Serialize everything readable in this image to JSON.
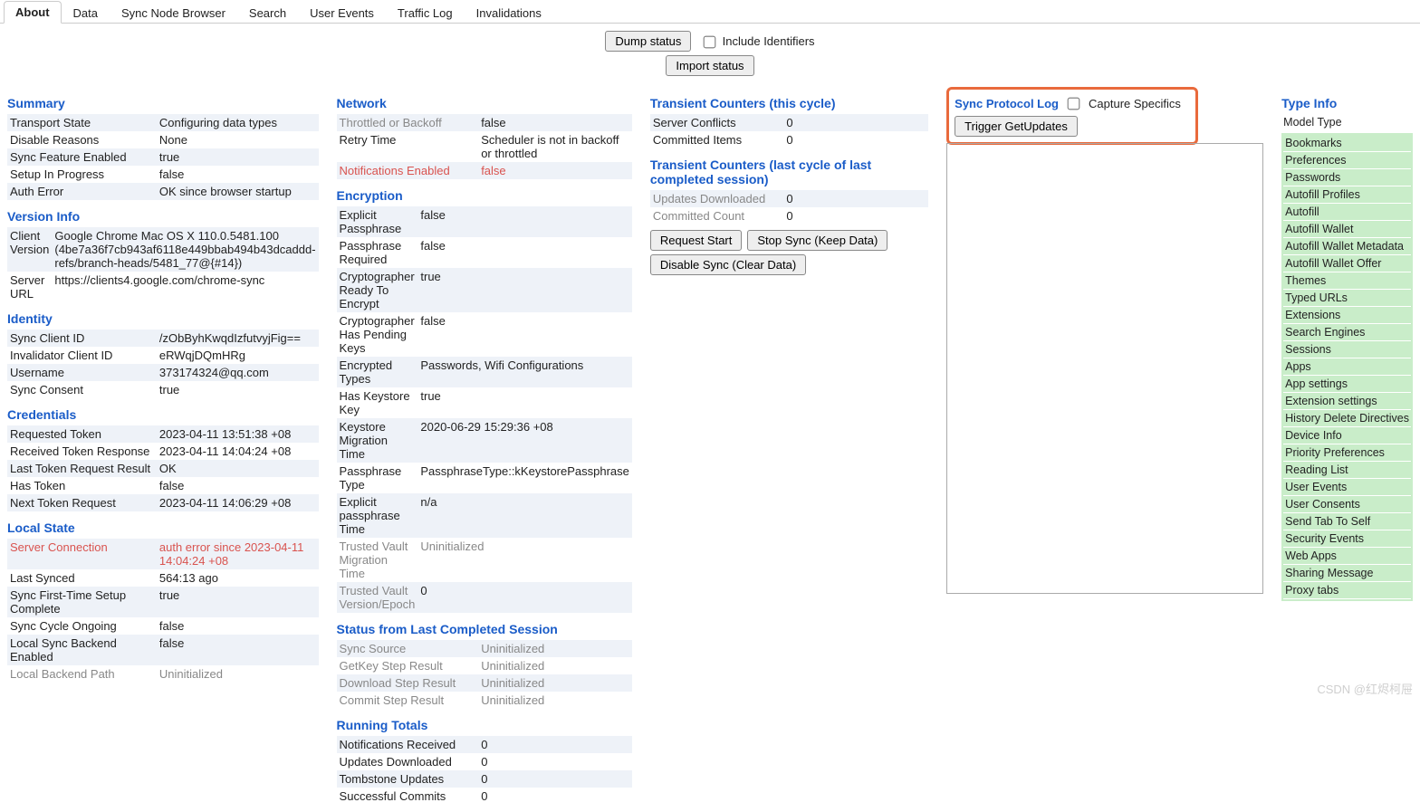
{
  "tabs": [
    "About",
    "Data",
    "Sync Node Browser",
    "Search",
    "User Events",
    "Traffic Log",
    "Invalidations"
  ],
  "activeTab": "About",
  "toolbar": {
    "dump": "Dump status",
    "include": "Include Identifiers",
    "import": "Import status"
  },
  "summary": {
    "title": "Summary",
    "rows": [
      [
        "Transport State",
        "Configuring data types"
      ],
      [
        "Disable Reasons",
        "None"
      ],
      [
        "Sync Feature Enabled",
        "true"
      ],
      [
        "Setup In Progress",
        "false"
      ],
      [
        "Auth Error",
        "OK since browser startup"
      ]
    ]
  },
  "versionInfo": {
    "title": "Version Info",
    "rows": [
      [
        "Client Version",
        "Google Chrome Mac OS X 110.0.5481.100 (4be7a36f7cb943af6118e449bbab494b43dcaddd-refs/branch-heads/5481_77@{#14})"
      ],
      [
        "Server URL",
        "https://clients4.google.com/chrome-sync"
      ]
    ]
  },
  "identity": {
    "title": "Identity",
    "rows": [
      [
        "Sync Client ID",
        "/zObByhKwqdIzfutvyjFig=="
      ],
      [
        "Invalidator Client ID",
        "eRWqjDQmHRg"
      ],
      [
        "Username",
        "373174324@qq.com"
      ],
      [
        "Sync Consent",
        "true"
      ]
    ]
  },
  "credentials": {
    "title": "Credentials",
    "rows": [
      [
        "Requested Token",
        "2023-04-11 13:51:38 +08"
      ],
      [
        "Received Token Response",
        "2023-04-11 14:04:24 +08"
      ],
      [
        "Last Token Request Result",
        "OK"
      ],
      [
        "Has Token",
        "false"
      ],
      [
        "Next Token Request",
        "2023-04-11 14:06:29 +08"
      ]
    ]
  },
  "localState": {
    "title": "Local State",
    "rows": [
      {
        "k": "Server Connection",
        "v": "auth error since 2023-04-11 14:04:24 +08",
        "kred": true,
        "vred": true
      },
      {
        "k": "Last Synced",
        "v": "564:13 ago"
      },
      {
        "k": "Sync First-Time Setup Complete",
        "v": "true"
      },
      {
        "k": "Sync Cycle Ongoing",
        "v": "false"
      },
      {
        "k": "Local Sync Backend Enabled",
        "v": "false"
      },
      {
        "k": "Local Backend Path",
        "v": "Uninitialized",
        "kgray": true,
        "vgray": true
      }
    ]
  },
  "network": {
    "title": "Network",
    "rows": [
      {
        "k": "Throttled or Backoff",
        "v": "false",
        "kgray": true
      },
      {
        "k": "Retry Time",
        "v": "Scheduler is not in backoff or throttled"
      },
      {
        "k": "Notifications Enabled",
        "v": "false",
        "kred": true,
        "vred": true
      }
    ]
  },
  "encryption": {
    "title": "Encryption",
    "rows": [
      [
        "Explicit Passphrase",
        "false"
      ],
      [
        "Passphrase Required",
        "false"
      ],
      [
        "Cryptographer Ready To Encrypt",
        "true"
      ],
      [
        "Cryptographer Has Pending Keys",
        "false"
      ],
      [
        "Encrypted Types",
        "Passwords, Wifi Configurations"
      ],
      [
        "Has Keystore Key",
        "true"
      ],
      [
        "Keystore Migration Time",
        "2020-06-29 15:29:36 +08"
      ],
      [
        "Passphrase Type",
        "PassphraseType::kKeystorePassphrase"
      ],
      [
        "Explicit passphrase Time",
        "n/a"
      ],
      {
        "k": "Trusted Vault Migration Time",
        "v": "Uninitialized",
        "kgray": true,
        "vgray": true
      },
      {
        "k": "Trusted Vault Version/Epoch",
        "v": "0",
        "kgray": true
      }
    ]
  },
  "lastSession": {
    "title": "Status from Last Completed Session",
    "rows": [
      {
        "k": "Sync Source",
        "v": "Uninitialized",
        "kgray": true,
        "vgray": true
      },
      {
        "k": "GetKey Step Result",
        "v": "Uninitialized",
        "kgray": true,
        "vgray": true
      },
      {
        "k": "Download Step Result",
        "v": "Uninitialized",
        "kgray": true,
        "vgray": true
      },
      {
        "k": "Commit Step Result",
        "v": "Uninitialized",
        "kgray": true,
        "vgray": true
      }
    ]
  },
  "running": {
    "title": "Running Totals",
    "rows": [
      [
        "Notifications Received",
        "0"
      ],
      [
        "Updates Downloaded",
        "0"
      ],
      [
        "Tombstone Updates",
        "0"
      ],
      [
        "Successful Commits",
        "0"
      ]
    ]
  },
  "transCycle": {
    "title": "Transient Counters (this cycle)",
    "rows": [
      [
        "Server Conflicts",
        "0"
      ],
      [
        "Committed Items",
        "0"
      ]
    ]
  },
  "transLast": {
    "title": "Transient Counters (last cycle of last completed session)",
    "rows": [
      {
        "k": "Updates Downloaded",
        "v": "0",
        "kgray": true
      },
      {
        "k": "Committed Count",
        "v": "0",
        "kgray": true
      }
    ]
  },
  "buttons": {
    "requestStart": "Request Start",
    "stopSync": "Stop Sync (Keep Data)",
    "disableSync": "Disable Sync (Clear Data)"
  },
  "protocol": {
    "title": "Sync Protocol Log",
    "capture": "Capture Specifics",
    "trigger": "Trigger GetUpdates"
  },
  "typeInfo": {
    "title": "Type Info",
    "modelType": "Model Type",
    "types": [
      "Bookmarks",
      "Preferences",
      "Passwords",
      "Autofill Profiles",
      "Autofill",
      "Autofill Wallet",
      "Autofill Wallet Metadata",
      "Autofill Wallet Offer",
      "Themes",
      "Typed URLs",
      "Extensions",
      "Search Engines",
      "Sessions",
      "Apps",
      "App settings",
      "Extension settings",
      "History Delete Directives",
      "Device Info",
      "Priority Preferences",
      "Reading List",
      "User Events",
      "User Consents",
      "Send Tab To Self",
      "Security Events",
      "Web Apps",
      "Sharing Message",
      "Proxy tabs"
    ]
  },
  "watermark": "CSDN @红烬柯屉"
}
